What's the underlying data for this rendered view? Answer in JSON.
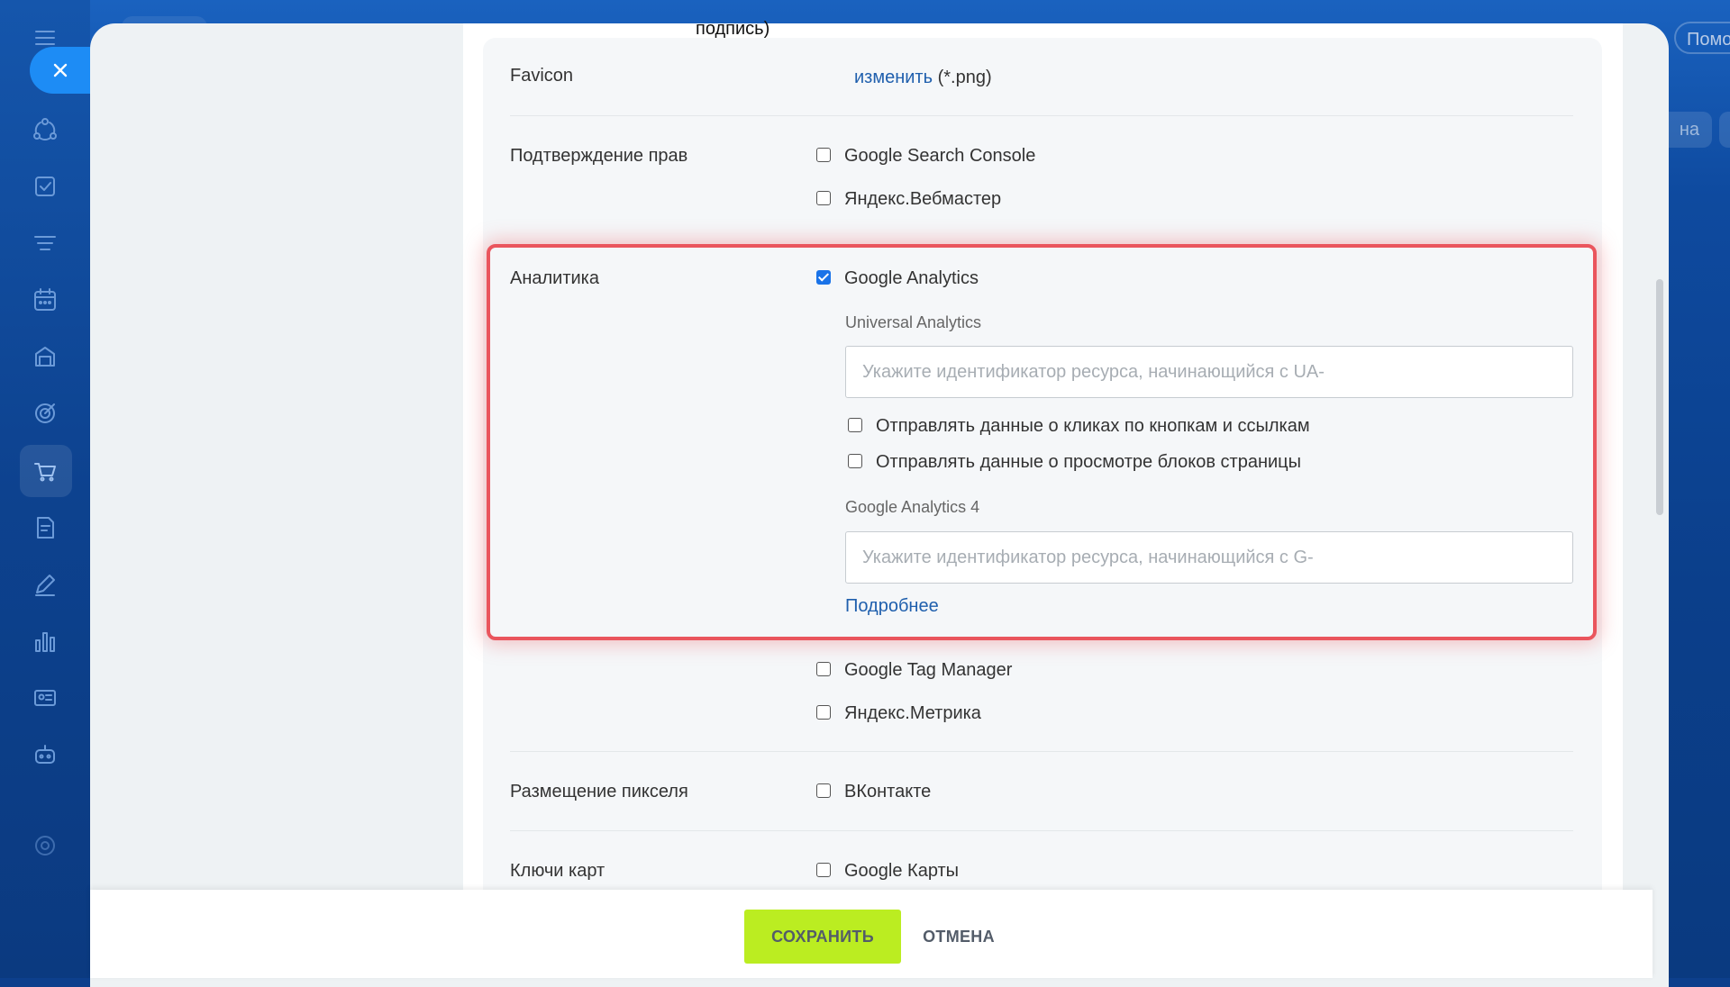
{
  "top_bar": {
    "help_label": "Помо",
    "right_button_label": "на"
  },
  "form": {
    "cut_text": "подпись)",
    "favicon": {
      "label": "Favicon",
      "link": "изменить",
      "hint": "(*.png)"
    },
    "verification": {
      "label": "Подтверждение прав",
      "options": [
        {
          "label": "Google Search Console",
          "checked": false
        },
        {
          "label": "Яндекс.Вебмастер",
          "checked": false
        }
      ]
    },
    "analytics": {
      "label": "Аналитика",
      "google_analytics": {
        "label": "Google Analytics",
        "checked": true
      },
      "universal": {
        "title": "Universal Analytics",
        "placeholder": "Укажите идентификатор ресурса, начинающийся с UA-",
        "value": "",
        "options": [
          {
            "label": "Отправлять данные о кликах по кнопкам и ссылкам",
            "checked": false
          },
          {
            "label": "Отправлять данные о просмотре блоков страницы",
            "checked": false
          }
        ]
      },
      "ga4": {
        "title": "Google Analytics 4",
        "placeholder": "Укажите идентификатор ресурса, начинающийся с G-",
        "value": ""
      },
      "more_link": "Подробнее",
      "other_options": [
        {
          "label": "Google Tag Manager",
          "checked": false
        },
        {
          "label": "Яндекс.Метрика",
          "checked": false
        }
      ]
    },
    "pixel": {
      "label": "Размещение пикселя",
      "options": [
        {
          "label": "ВКонтакте",
          "checked": false
        }
      ]
    },
    "map_keys": {
      "label": "Ключи карт",
      "options": [
        {
          "label": "Google Карты",
          "checked": false
        }
      ]
    }
  },
  "footer": {
    "save_label": "СОХРАНИТЬ",
    "cancel_label": "ОТМЕНА"
  },
  "colors": {
    "accent_link": "#1f5fad",
    "save_button": "#bbed21",
    "highlight_border": "#ea555d",
    "checkbox_checked": "#1a73e8"
  }
}
